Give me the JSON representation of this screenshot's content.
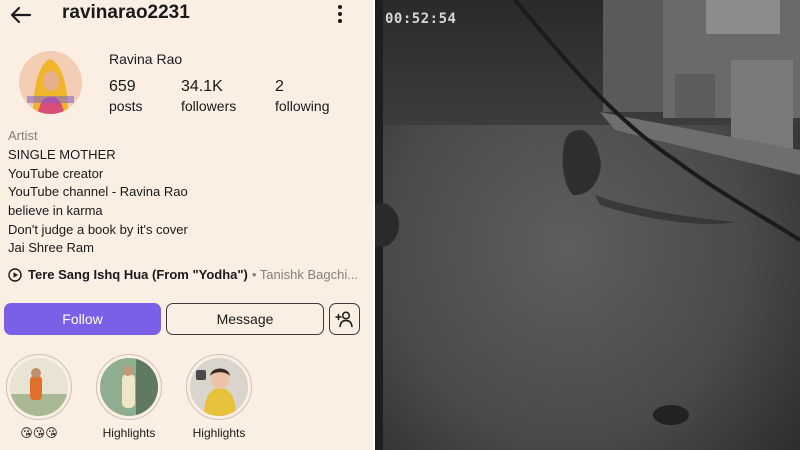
{
  "profile": {
    "username": "ravinarao2231",
    "display_name": "Ravina Rao",
    "stats": [
      {
        "value": "659",
        "label": "posts"
      },
      {
        "value": "34.1K",
        "label": "followers"
      },
      {
        "value": "2",
        "label": "following"
      }
    ],
    "category": "Artist",
    "bio_lines": [
      "SINGLE MOTHER",
      "YouTube creator",
      "YouTube channel - Ravina Rao",
      "believe in karma",
      "Don't judge a book by it's cover",
      "Jai Shree Ram"
    ],
    "music": {
      "song": "Tere Sang Ishq Hua (From \"Yodha\")",
      "artist": "• Tanishk Bagchi..."
    },
    "buttons": {
      "follow": "Follow",
      "message": "Message"
    },
    "highlights": [
      {
        "label": "😘😘😘"
      },
      {
        "label": "Highlights"
      },
      {
        "label": "Highlights"
      }
    ],
    "colors": {
      "background": "#fbeee3",
      "follow_button": "#7a60e6",
      "secondary_text": "#8a7e77"
    },
    "icons": {
      "back": "arrow-left-icon",
      "menu": "kebab-menu-icon",
      "music": "play-circle-icon",
      "add_user": "add-user-icon"
    }
  },
  "cctv": {
    "timestamp": "00:52:54"
  }
}
